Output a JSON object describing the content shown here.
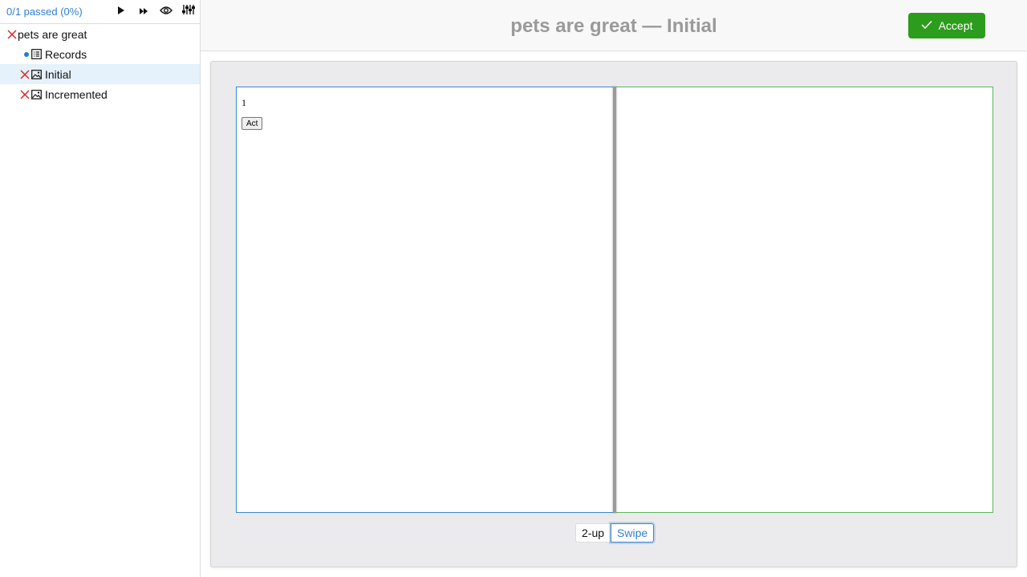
{
  "sidebar": {
    "pass_status": "0/1 passed (0%)",
    "toolbar": {
      "run_icon": "play-icon",
      "run_all_icon": "fast-forward-icon",
      "watch_icon": "eye-icon",
      "settings_icon": "sliders-icon"
    },
    "tree": [
      {
        "label": "pets are great",
        "status": "failed",
        "kind": "story",
        "level": 0
      },
      {
        "label": "Records",
        "status": "info",
        "kind": "records",
        "level": 1
      },
      {
        "label": "Initial",
        "status": "failed",
        "kind": "screenshot",
        "level": 1,
        "selected": true
      },
      {
        "label": "Incremented",
        "status": "failed",
        "kind": "screenshot",
        "level": 1
      }
    ]
  },
  "header": {
    "title": "pets are great — Initial",
    "accept_label": "Accept"
  },
  "comparison": {
    "rendered_count": "1",
    "act_label": "Act",
    "modes": [
      "2-up",
      "Swipe"
    ],
    "active_mode": "Swipe",
    "swipe_position": 0.5
  },
  "colors": {
    "accent": "#2f7fd6",
    "accept": "#2c9c1c",
    "failed": "#e02424",
    "selected_bg": "#e5f1fb",
    "left_border": "#3b86d4",
    "right_border": "#5cb85c"
  }
}
